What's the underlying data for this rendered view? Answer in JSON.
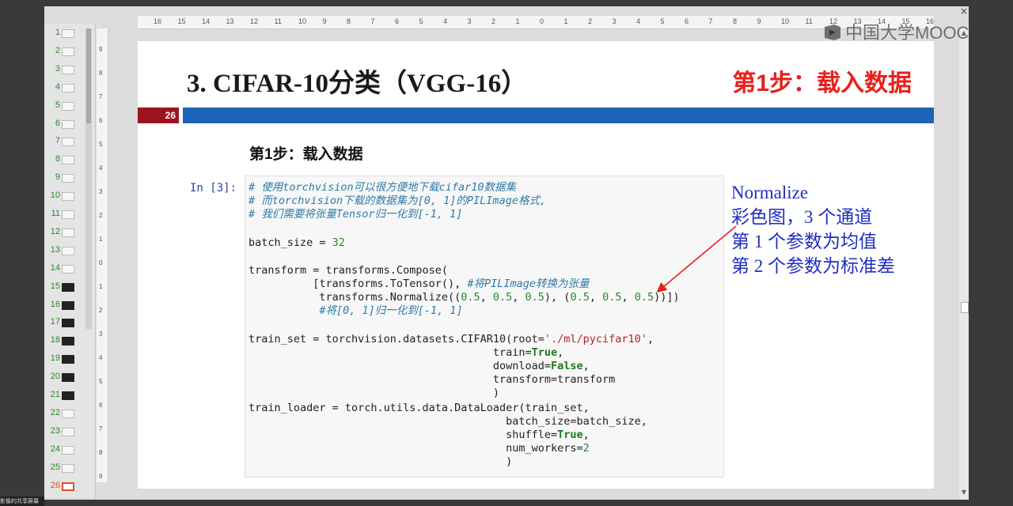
{
  "window": {
    "close_glyph": "×",
    "share_label": "影像的共享屏幕"
  },
  "watermark": {
    "text": "中国大学MOOC"
  },
  "thumbnails": {
    "current": 26,
    "items": [
      {
        "n": "1",
        "style": "light"
      },
      {
        "n": "2",
        "style": "light"
      },
      {
        "n": "3",
        "style": "light"
      },
      {
        "n": "4",
        "style": "light"
      },
      {
        "n": "5",
        "style": "light"
      },
      {
        "n": "6",
        "style": "light"
      },
      {
        "n": "7",
        "style": "light"
      },
      {
        "n": "8",
        "style": "light"
      },
      {
        "n": "9",
        "style": "light"
      },
      {
        "n": "10",
        "style": "light"
      },
      {
        "n": "11",
        "style": "light"
      },
      {
        "n": "12",
        "style": "light"
      },
      {
        "n": "13",
        "style": "light"
      },
      {
        "n": "14",
        "style": "light"
      },
      {
        "n": "15",
        "style": "dark"
      },
      {
        "n": "16",
        "style": "dark"
      },
      {
        "n": "17",
        "style": "dark"
      },
      {
        "n": "18",
        "style": "dark"
      },
      {
        "n": "19",
        "style": "dark"
      },
      {
        "n": "20",
        "style": "dark"
      },
      {
        "n": "21",
        "style": "dark"
      },
      {
        "n": "22",
        "style": "light"
      },
      {
        "n": "23",
        "style": "light"
      },
      {
        "n": "24",
        "style": "light"
      },
      {
        "n": "25",
        "style": "light"
      },
      {
        "n": "26",
        "style": "active"
      }
    ]
  },
  "ruler": {
    "horizontal": [
      "16",
      "15",
      "14",
      "13",
      "12",
      "11",
      "10",
      "9",
      "8",
      "7",
      "6",
      "5",
      "4",
      "3",
      "2",
      "1",
      "0",
      "1",
      "2",
      "3",
      "4",
      "5",
      "6",
      "7",
      "8",
      "9",
      "10",
      "11",
      "12",
      "13",
      "14",
      "15",
      "16"
    ],
    "vertical": [
      "9",
      "8",
      "7",
      "6",
      "5",
      "4",
      "3",
      "2",
      "1",
      "0",
      "1",
      "2",
      "3",
      "4",
      "5",
      "6",
      "7",
      "8",
      "9"
    ]
  },
  "slide": {
    "title": "3.  CIFAR-10分类（VGG-16）",
    "step_title": "第1步：载入数据",
    "page_number": "26",
    "sub_heading": "第1步：载入数据",
    "in_prompt": "In [3]:",
    "annotation": [
      "Normalize",
      "彩色图，3 个通道",
      "第 1 个参数为均值",
      "第 2 个参数为标准差"
    ],
    "accent_red": "#e8201d",
    "accent_blue": "#1f63b8",
    "badge_color": "#9c1421"
  },
  "code": {
    "comment1": "# 使用torchvision可以很方便地下载cifar10数据集",
    "comment2": "# 而torchvision下载的数据集为[0, 1]的PILImage格式,",
    "comment3": "# 我们需要将张量Tensor归一化到[-1, 1]",
    "batch_a": "batch_size = ",
    "batch_num": "32",
    "tf_line": "transform = transforms.Compose(",
    "totensor_code": "          [transforms.ToTensor(), ",
    "totensor_comment": "#将PILImage转换为张量",
    "norm_a": "           transforms.Normalize((",
    "n1": "0.5",
    "sep": ", ",
    "n2": "0.5",
    "n3": "0.5",
    "norm_mid": "), (",
    "n4": "0.5",
    "n5": "0.5",
    "n6": "0.5",
    "norm_end": "))])",
    "norm_comment": "           #将[0, 1]归一化到[-1, 1]",
    "ts_a": "train_set = torchvision.datasets.CIFAR10(root=",
    "ts_str": "'./ml/pycifar10'",
    "ts_comma": ",",
    "train_a": "                                      train=",
    "train_val": "True",
    "train_c": ",",
    "dl_a": "                                      download=",
    "dl_val": "False",
    "dl_c": ",",
    "tf_arg": "                                      transform=transform",
    "paren1": "                                      )",
    "tl_a": "train_loader = torch.utils.data.DataLoader(train_set,",
    "bs_arg": "                                        batch_size=batch_size,",
    "sh_a": "                                        shuffle=",
    "sh_val": "True",
    "sh_c": ",",
    "nw_a": "                                        num_workers=",
    "nw_val": "2",
    "paren2": "                                        )"
  }
}
